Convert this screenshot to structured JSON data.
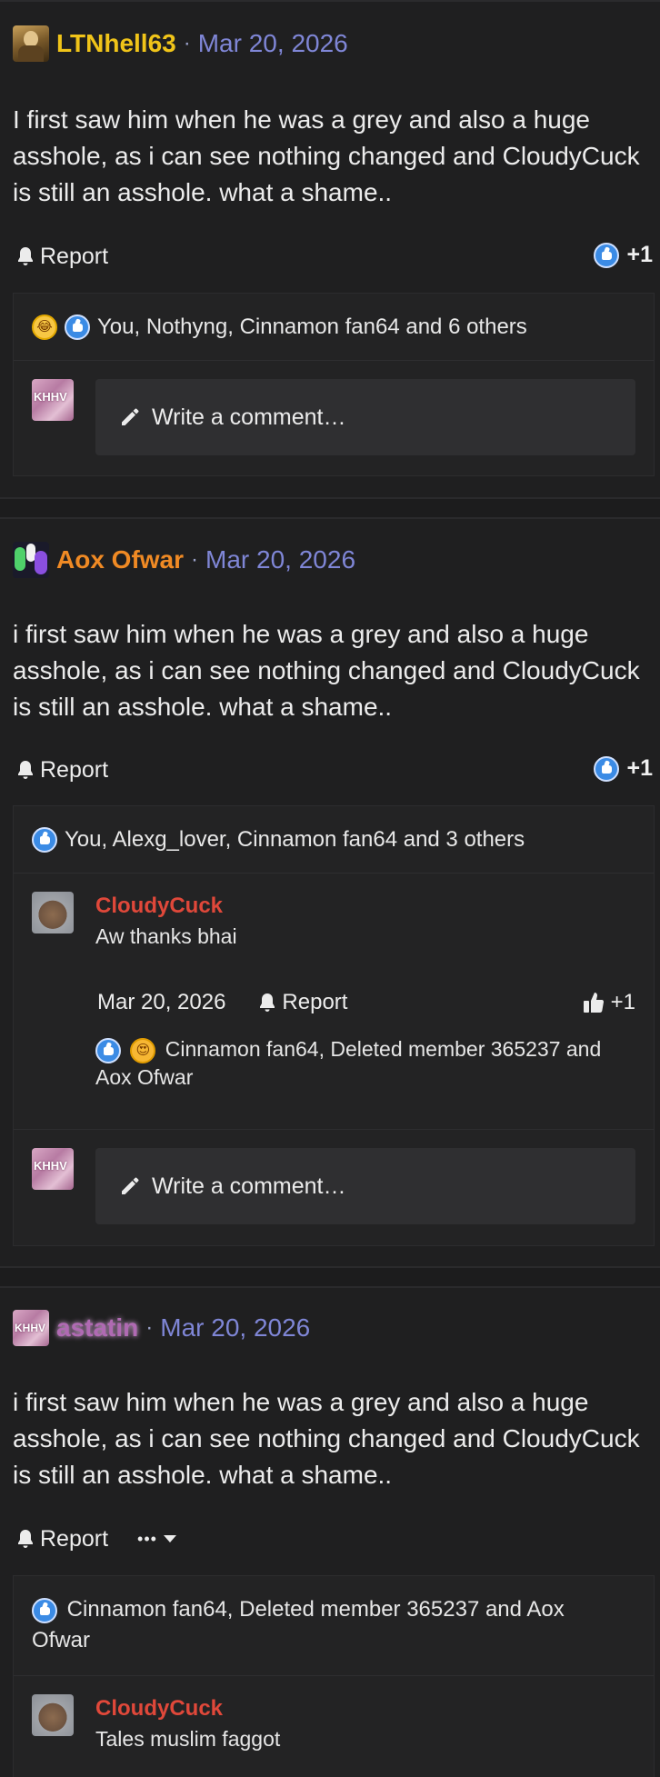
{
  "colors": {
    "background": "#1f1f20",
    "date_link": "#7f86d6",
    "like_blue": "#3b8be5",
    "comment_author": "#e0483a"
  },
  "posts": [
    {
      "username": "LTNhell63",
      "username_color": "#f0c419",
      "date": "Mar 20, 2026",
      "body": "I first saw him when he was a grey and also a huge asshole, as i can see nothing changed and CloudyCuck is still an asshole. what a shame..",
      "report_label": "Report",
      "like_count": "+1",
      "reactions_text": "You, Nothyng, Cinnamon fan64 and 6 others",
      "write_placeholder": "Write a comment…"
    },
    {
      "username": "Aox Ofwar",
      "username_color": "#f08a24",
      "date": "Mar 20, 2026",
      "body": "i first saw him when he was a grey and also a huge asshole, as i can see nothing changed and CloudyCuck is still an asshole. what a shame..",
      "report_label": "Report",
      "like_count": "+1",
      "reactions_text": "You, Alexg_lover, Cinnamon fan64 and 3 others",
      "comment": {
        "author": "CloudyCuck",
        "text": "Aw thanks bhai",
        "date": "Mar 20, 2026",
        "report_label": "Report",
        "like_count": "+1",
        "reactions_text": "Cinnamon fan64, Deleted member 365237 and Aox Ofwar"
      },
      "write_placeholder": "Write a comment…"
    },
    {
      "username": "astatin",
      "username_color": "#b06ab3",
      "date": "Mar 20, 2026",
      "body": "i first saw him when he was a grey and also a huge asshole, as i can see nothing changed and CloudyCuck is still an asshole. what a shame..",
      "report_label": "Report",
      "more_label": "•••",
      "reactions_text": "Cinnamon fan64, Deleted member 365237 and Aox Ofwar",
      "comment": {
        "author": "CloudyCuck",
        "text": "Tales muslim faggot"
      }
    }
  ],
  "avatar_text": "KHHV",
  "separator": "·"
}
